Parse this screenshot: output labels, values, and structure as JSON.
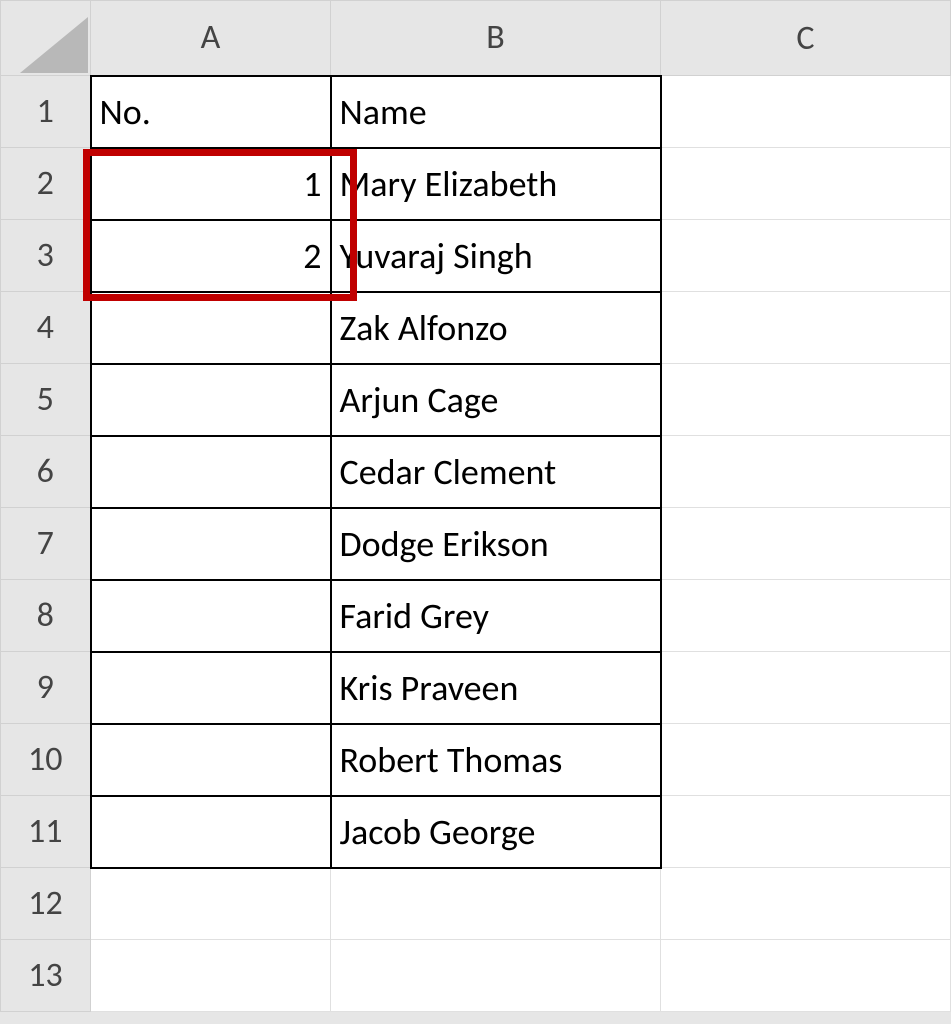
{
  "columns": [
    "A",
    "B",
    "C"
  ],
  "row_numbers": [
    "1",
    "2",
    "3",
    "4",
    "5",
    "6",
    "7",
    "8",
    "9",
    "10",
    "11",
    "12",
    "13"
  ],
  "headers": {
    "A": "No.",
    "B": "Name"
  },
  "rows": [
    {
      "no": "1",
      "name": "Mary Elizabeth"
    },
    {
      "no": "2",
      "name": "Yuvaraj Singh"
    },
    {
      "no": "",
      "name": "Zak Alfonzo"
    },
    {
      "no": "",
      "name": "Arjun Cage"
    },
    {
      "no": "",
      "name": "Cedar Clement"
    },
    {
      "no": "",
      "name": "Dodge Erikson"
    },
    {
      "no": "",
      "name": "Farid Grey"
    },
    {
      "no": "",
      "name": "Kris Praveen"
    },
    {
      "no": "",
      "name": "Robert Thomas"
    },
    {
      "no": "",
      "name": "Jacob George"
    }
  ],
  "highlight": {
    "range": "A2:A3"
  }
}
